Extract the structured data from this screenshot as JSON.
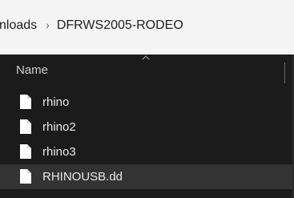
{
  "breadcrumb": {
    "items": [
      "nloads",
      "DFRWS2005-RODEO"
    ],
    "separator": "›"
  },
  "list_header": {
    "name_label": "Name",
    "sort_icon": "chevron-up-icon"
  },
  "files": [
    {
      "name": "rhino",
      "icon": "file-icon",
      "selected": false
    },
    {
      "name": "rhino2",
      "icon": "file-icon",
      "selected": false
    },
    {
      "name": "rhino3",
      "icon": "file-icon",
      "selected": false
    },
    {
      "name": "RHINOUSB.dd",
      "icon": "file-icon",
      "selected": true
    }
  ],
  "colors": {
    "address_bar_bg": "#f4f4f4",
    "pane_bg": "#1b1b1b",
    "selected_row": "#333333",
    "text_primary": "#e8e8e8",
    "text_secondary": "#cfcfcf"
  }
}
